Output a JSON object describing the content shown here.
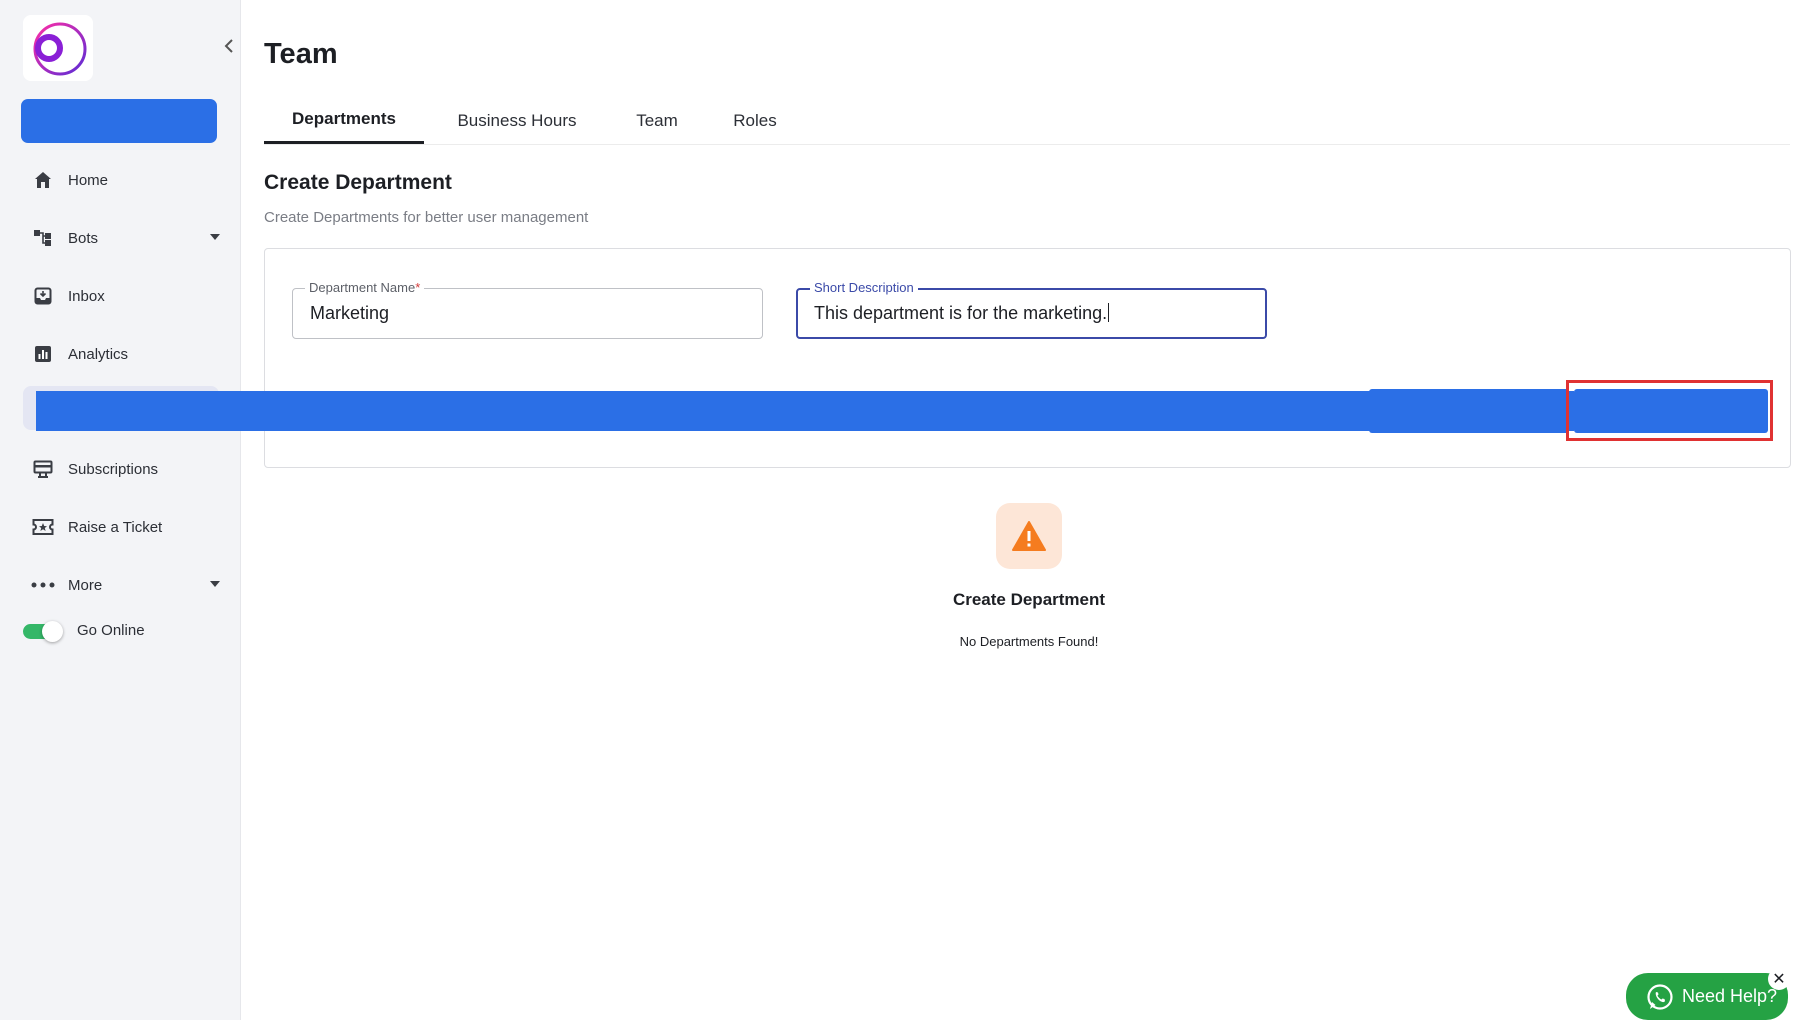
{
  "sidebar": {
    "items": [
      {
        "label": "Home",
        "icon": "home-icon"
      },
      {
        "label": "Bots",
        "icon": "bots-icon",
        "has_caret": true
      },
      {
        "label": "Inbox",
        "icon": "inbox-icon"
      },
      {
        "label": "Analytics",
        "icon": "analytics-icon"
      },
      {
        "label": "Subscriptions",
        "icon": "subscriptions-icon"
      },
      {
        "label": "Raise a Ticket",
        "icon": "ticket-icon"
      },
      {
        "label": "More",
        "icon": "more-dots-icon",
        "has_caret": true
      }
    ],
    "go_online_label": "Go Online",
    "go_online_on": true
  },
  "page": {
    "title": "Team",
    "tabs": [
      "Departments",
      "Business Hours",
      "Team",
      "Roles"
    ],
    "active_tab": "Departments"
  },
  "create": {
    "title": "Create Department",
    "subtitle": "Create Departments for better user management",
    "name_label": "Department Name",
    "name_required_mark": "*",
    "name_value": "Marketing",
    "desc_label": "Short Description",
    "desc_value": "This department is for the marketing."
  },
  "empty_state": {
    "title": "Create Department",
    "message": "No Departments Found!"
  },
  "help": {
    "label": "Need Help?",
    "close": "✕"
  },
  "colors": {
    "accent_blue": "#2b6fe6",
    "highlight_red": "#e03232",
    "toggle_green": "#34b768",
    "whatsapp_green": "#25a244",
    "warning_orange": "#f57c1f"
  }
}
